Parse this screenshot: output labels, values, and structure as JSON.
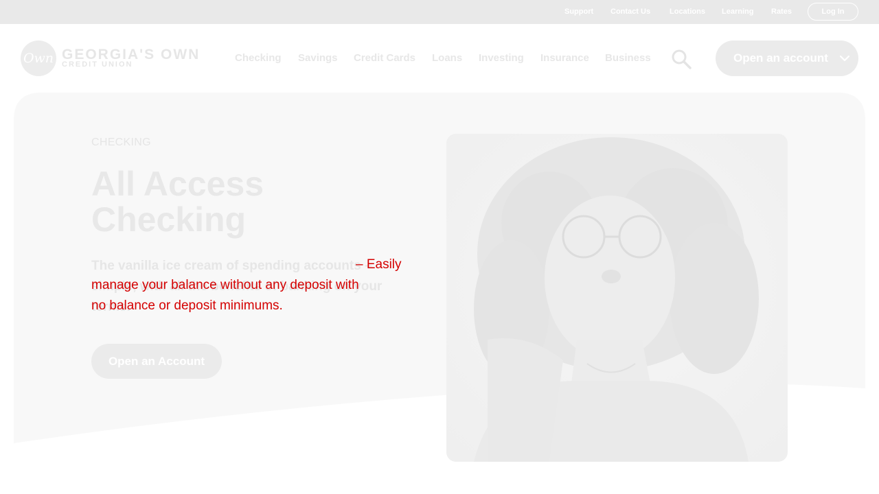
{
  "utility_nav": {
    "links": [
      "Support",
      "Contact Us",
      "Locations",
      "Learning",
      "Rates"
    ],
    "login_label": "Log In"
  },
  "brand": {
    "mark": "Own",
    "name": "GEORGIA'S OWN",
    "sub": "CREDIT UNION"
  },
  "main_nav": {
    "items": [
      "Checking",
      "Savings",
      "Credit Cards",
      "Loans",
      "Investing",
      "Insurance",
      "Business"
    ],
    "search_icon": "search-icon",
    "open_account_label": "Open an account",
    "open_account_icon": "chevron-down-icon"
  },
  "hero": {
    "eyebrow": "CHECKING",
    "title_line1": "All Access",
    "title_line2": "Checking",
    "description": "The vanilla ice cream of spending accounts – simple, with all the benefits of banking on your terms.",
    "overlay_lines": [
      "– Easily",
      "manage your balance without any deposit with",
      "no balance or deposit minimums."
    ],
    "cta_label": "Open an Account"
  },
  "colors": {
    "utility_bar": "#e9e9e9",
    "overlay_text": "#d40000",
    "button_fill": "#ebebeb",
    "hero_panel": "#f8f8f8"
  }
}
